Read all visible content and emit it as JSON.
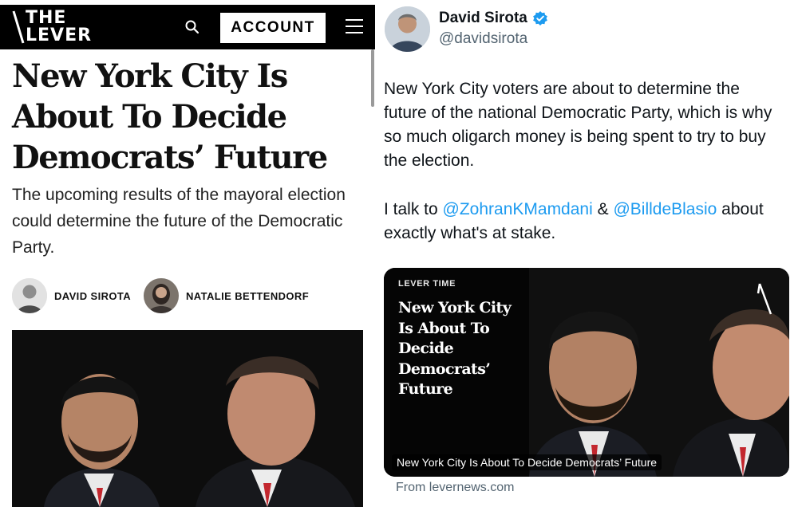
{
  "article": {
    "header": {
      "logo_line1": "THE",
      "logo_line2": "LEVER",
      "account_label": "ACCOUNT",
      "icons": [
        "search-icon",
        "menu-icon",
        "lever-logo-icon"
      ]
    },
    "headline": "New York City Is About To Decide Democrats’ Future",
    "dek": "The upcoming results of the mayoral election could determine the future of the Democratic Party.",
    "authors": [
      {
        "name": "DAVID SIROTA"
      },
      {
        "name": "NATALIE BETTENDORF"
      }
    ]
  },
  "tweet": {
    "display_name": "David Sirota",
    "handle": "@davidsirota",
    "verified": true,
    "body_p1": "New York City voters are about to determine the future of the national Democratic Party, which is why so much oligarch money is being spent to try to buy the election.",
    "body_p2_prefix": "I talk to ",
    "mention_1": "@ZohranKMamdani",
    "body_p2_join": " & ",
    "mention_2": "@BilldeBlasio",
    "body_p2_suffix": " about exactly what's at stake.",
    "card": {
      "eyebrow": "LEVER TIME",
      "title": "New York City Is About To Decide Democrats’ Future",
      "caption": "New York City Is About To Decide Democrats’ Future",
      "source": "From levernews.com"
    }
  },
  "colors": {
    "link": "#1d9bf0",
    "verified": "#1d9bf0",
    "header_bg": "#000000",
    "muted": "#536471"
  }
}
